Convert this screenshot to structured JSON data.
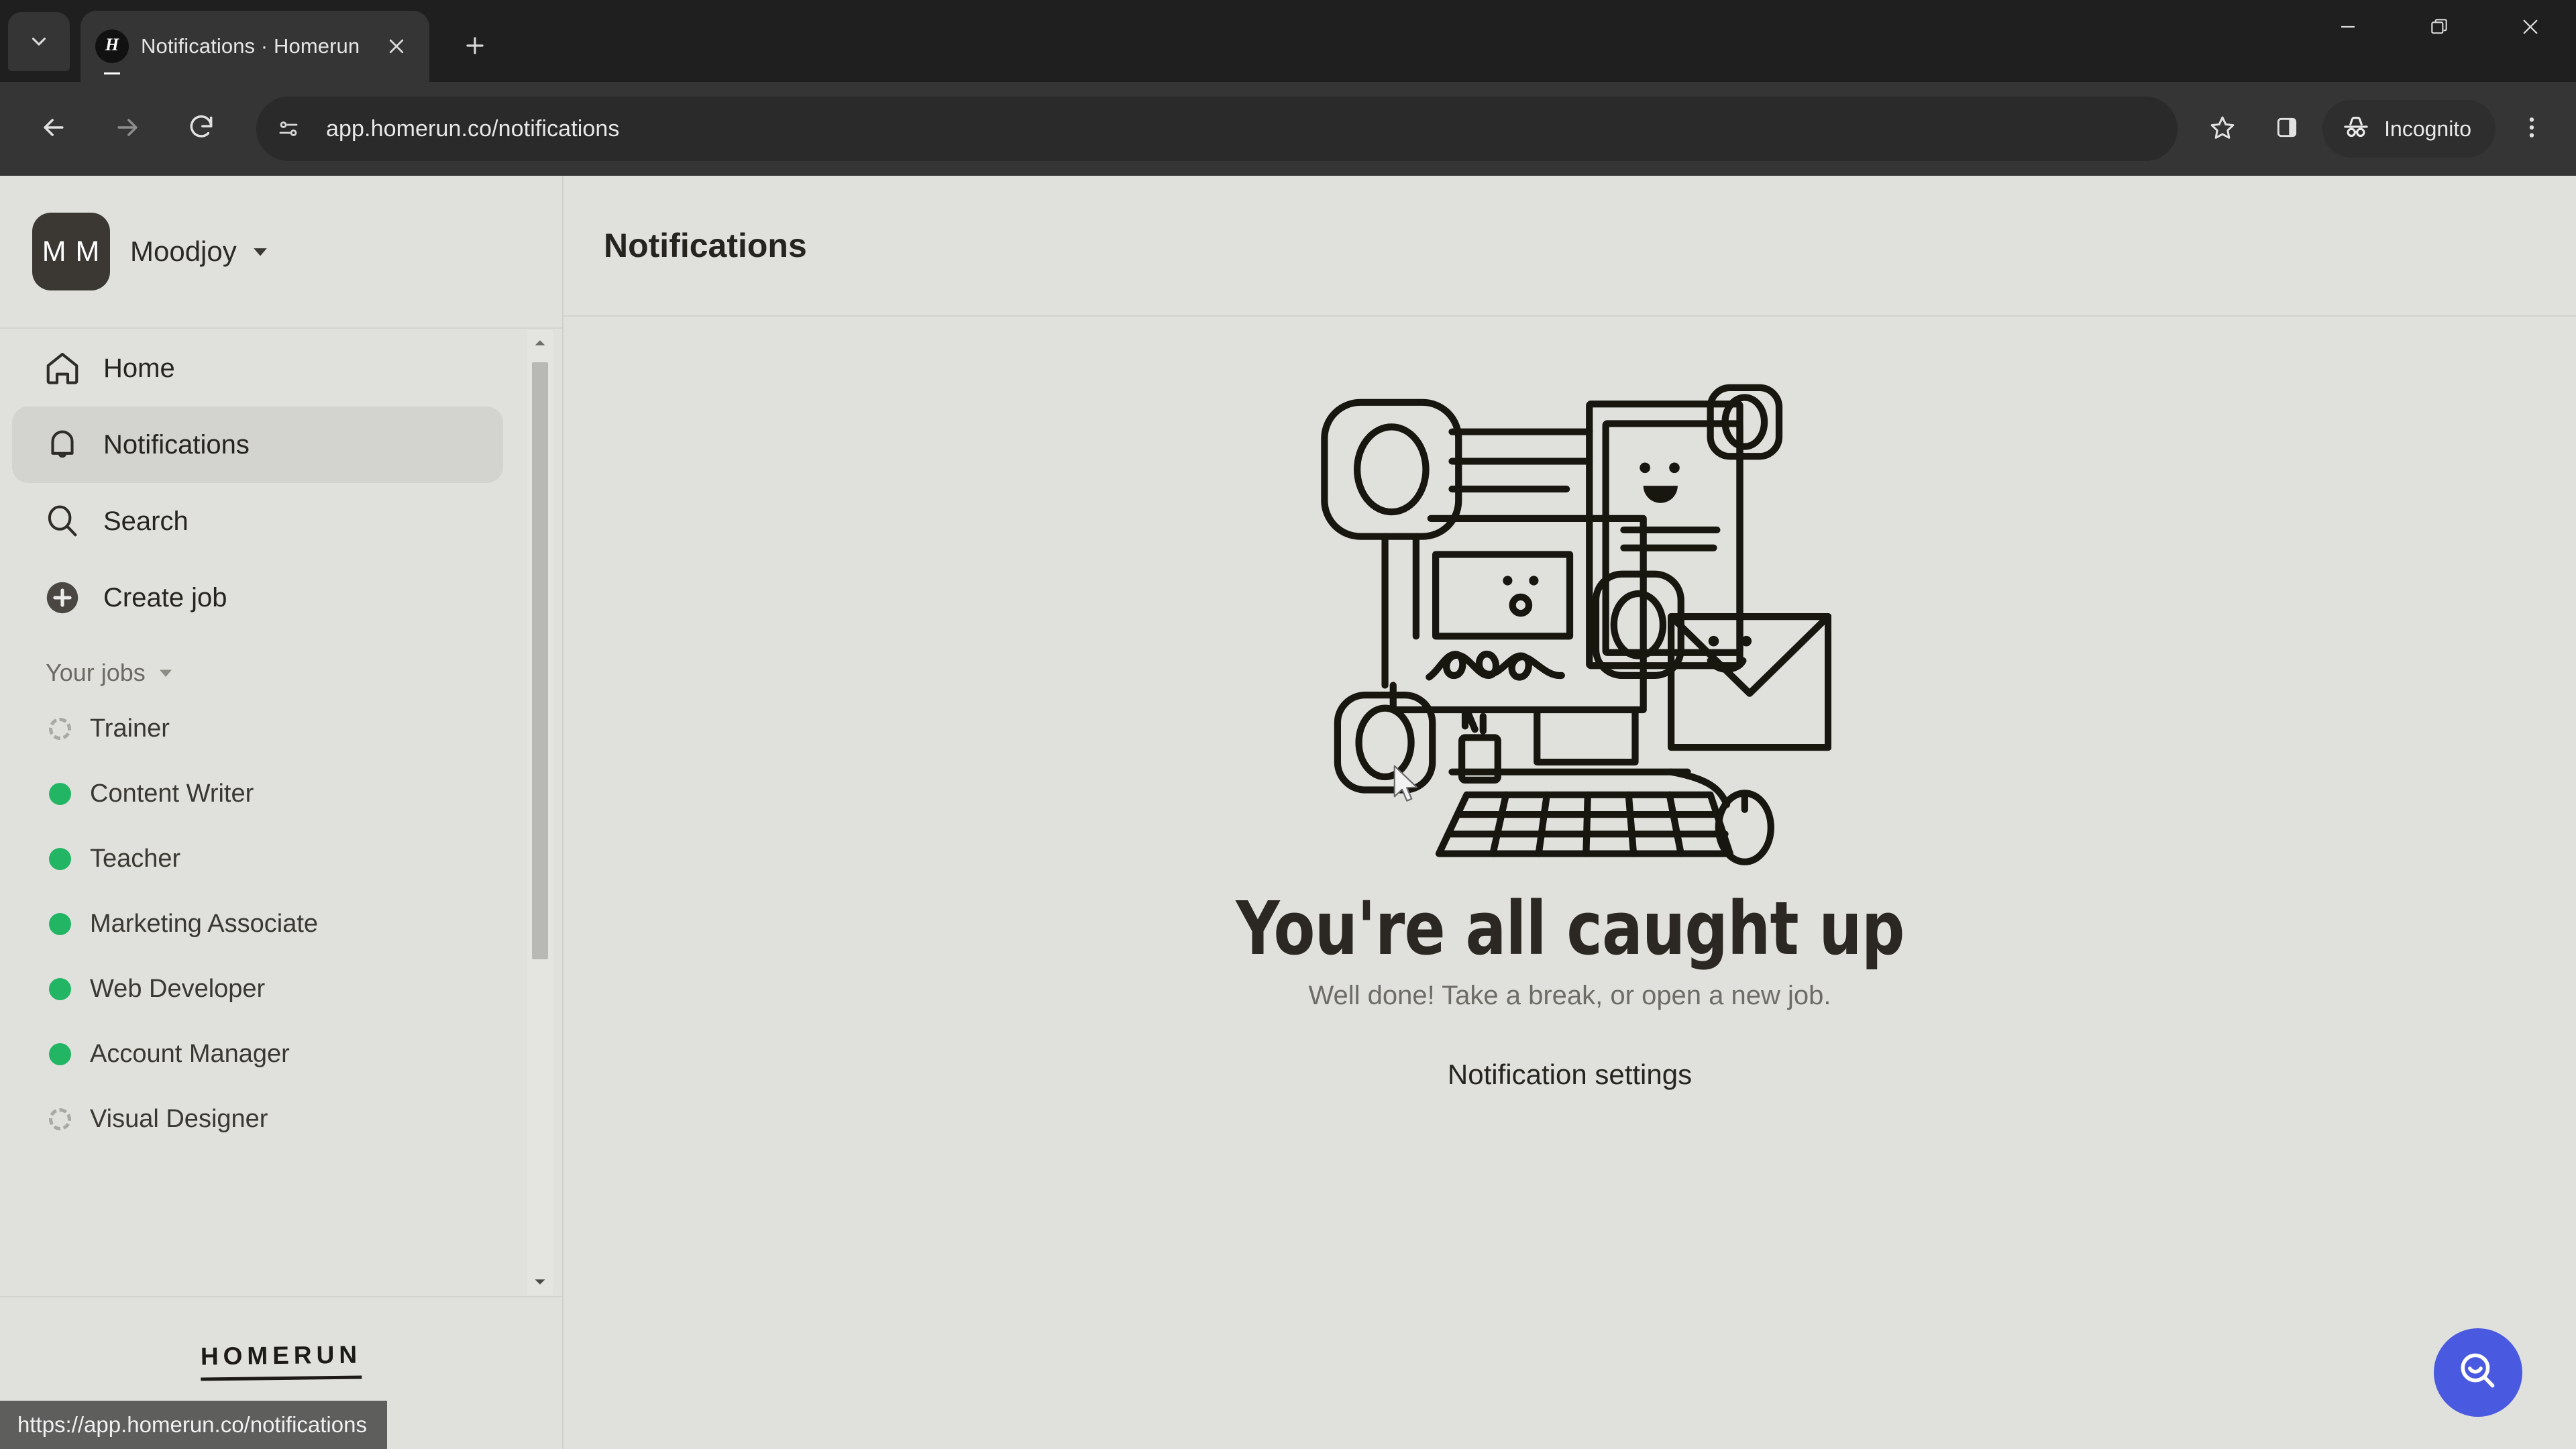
{
  "browser": {
    "tab_search_icon": "chevron-down-icon",
    "tab": {
      "favicon": "homerun-favicon",
      "favicon_letter": "H",
      "title": "Notifications · Homerun",
      "close_icon": "close-icon"
    },
    "new_tab_icon": "plus-icon",
    "window_controls": {
      "minimize": "minimize-icon",
      "maximize": "restore-icon",
      "close": "close-icon"
    },
    "toolbar": {
      "back_icon": "arrow-left-icon",
      "forward_icon": "arrow-right-icon",
      "reload_icon": "reload-icon",
      "site_info_icon": "tune-icon",
      "url": "app.homerun.co/notifications",
      "bookmark_icon": "star-icon",
      "side_panel_icon": "side-panel-icon",
      "incognito_icon": "incognito-icon",
      "incognito_label": "Incognito",
      "menu_icon": "kebab-menu-icon"
    }
  },
  "status_bar": {
    "url": "https://app.homerun.co/notifications"
  },
  "sidebar": {
    "org": {
      "avatar_initials": "M M",
      "name": "Moodjoy",
      "caret_icon": "caret-down-icon"
    },
    "nav": [
      {
        "label": "Home",
        "icon": "home-icon",
        "active": false
      },
      {
        "label": "Notifications",
        "icon": "bell-icon",
        "active": true
      },
      {
        "label": "Search",
        "icon": "search-icon",
        "active": false
      },
      {
        "label": "Create job",
        "icon": "plus-circle-icon",
        "active": false
      }
    ],
    "jobs_section": {
      "title": "Your jobs",
      "caret_icon": "caret-down-icon",
      "items": [
        {
          "label": "Trainer",
          "status": "draft"
        },
        {
          "label": "Content Writer",
          "status": "live"
        },
        {
          "label": "Teacher",
          "status": "live"
        },
        {
          "label": "Marketing Associate",
          "status": "live"
        },
        {
          "label": "Web Developer",
          "status": "live"
        },
        {
          "label": "Account Manager",
          "status": "live"
        },
        {
          "label": "Visual Designer",
          "status": "draft"
        }
      ]
    },
    "scrollbar": {
      "up_icon": "scroll-up-arrow-icon",
      "down_icon": "scroll-down-arrow-icon"
    },
    "footer_logo": "HOMERUN"
  },
  "main": {
    "page_title": "Notifications",
    "empty_state": {
      "illustration": "desk-computer-illustration",
      "headline": "You're all caught up",
      "subhead": "Well done! Take a break, or open a new job.",
      "cta_label": "Notification settings"
    },
    "fab": {
      "icon": "search-smile-icon"
    }
  },
  "colors": {
    "page_bg": "#e0e1dc",
    "sidebar_active": "#d3d4cf",
    "status_live": "#22b563",
    "status_draft": "#a9a8a3",
    "fab_bg": "#4a5ae0",
    "chrome_bg": "#1f1f1f",
    "toolbar_bg": "#353535"
  }
}
